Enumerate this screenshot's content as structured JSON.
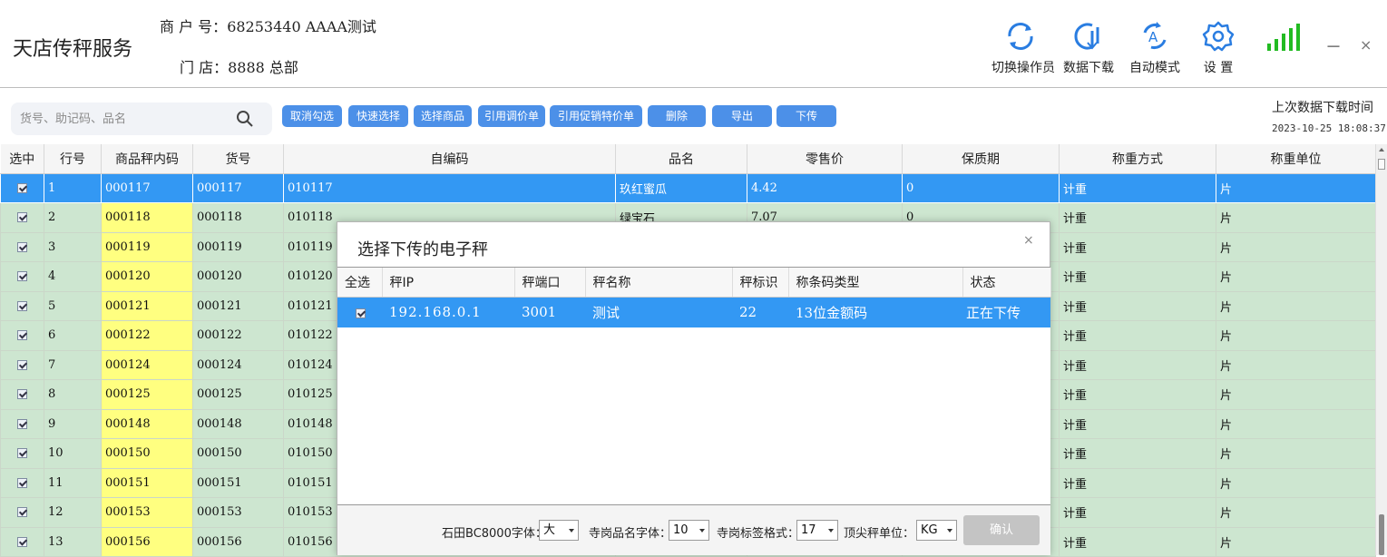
{
  "app": {
    "title": "天店传秤服务"
  },
  "merchant": {
    "label": "商 户 号：",
    "value": "68253440  AAAA测试"
  },
  "store": {
    "label": "门    店：",
    "value": "8888 总部"
  },
  "toolbar_top": [
    {
      "label": "切换操作员",
      "icon": "switch-operator-icon"
    },
    {
      "label": "数据下载",
      "icon": "data-download-icon"
    },
    {
      "label": "自动模式",
      "icon": "auto-mode-icon"
    },
    {
      "label": "设  置",
      "icon": "gear-icon"
    }
  ],
  "window": {
    "minimize": "－",
    "close": "×",
    "signal_color": "#22bb22"
  },
  "search": {
    "placeholder": "货号、助记码、品名"
  },
  "actions": [
    "取消勾选",
    "快速选择",
    "选择商品",
    "引用调价单",
    "引用促销特价单",
    "删除",
    "导出",
    "下传"
  ],
  "last_download": {
    "label": "上次数据下载时间",
    "time": "2023-10-25 18:08:37"
  },
  "colors": {
    "accent": "#4c90e8",
    "selected_row": "#3398f3",
    "row_bg": "#cde6d0",
    "code_bg": "#ffff80"
  },
  "table": {
    "headers": [
      "选中",
      "行号",
      "商品秤内码",
      "货号",
      "自编码",
      "品名",
      "零售价",
      "保质期",
      "称重方式",
      "称重单位"
    ],
    "rows": [
      {
        "no": "1",
        "code": "000117",
        "sku": "000117",
        "self": "010117",
        "name": "玖红蜜瓜",
        "price": "4.42",
        "shelf": "0",
        "method": "计重",
        "unit": "片"
      },
      {
        "no": "2",
        "code": "000118",
        "sku": "000118",
        "self": "010118",
        "name": "绿宝石",
        "price": "7.07",
        "shelf": "0",
        "method": "计重",
        "unit": "片"
      },
      {
        "no": "3",
        "code": "000119",
        "sku": "000119",
        "self": "010119",
        "name": "",
        "price": "",
        "shelf": "",
        "method": "计重",
        "unit": "片"
      },
      {
        "no": "4",
        "code": "000120",
        "sku": "000120",
        "self": "010120",
        "name": "",
        "price": "",
        "shelf": "",
        "method": "计重",
        "unit": "片"
      },
      {
        "no": "5",
        "code": "000121",
        "sku": "000121",
        "self": "010121",
        "name": "",
        "price": "",
        "shelf": "",
        "method": "计重",
        "unit": "片"
      },
      {
        "no": "6",
        "code": "000122",
        "sku": "000122",
        "self": "010122",
        "name": "",
        "price": "",
        "shelf": "",
        "method": "计重",
        "unit": "片"
      },
      {
        "no": "7",
        "code": "000124",
        "sku": "000124",
        "self": "010124",
        "name": "",
        "price": "",
        "shelf": "",
        "method": "计重",
        "unit": "片"
      },
      {
        "no": "8",
        "code": "000125",
        "sku": "000125",
        "self": "010125",
        "name": "",
        "price": "",
        "shelf": "",
        "method": "计重",
        "unit": "片"
      },
      {
        "no": "9",
        "code": "000148",
        "sku": "000148",
        "self": "010148",
        "name": "",
        "price": "",
        "shelf": "",
        "method": "计重",
        "unit": "片"
      },
      {
        "no": "10",
        "code": "000150",
        "sku": "000150",
        "self": "010150",
        "name": "",
        "price": "",
        "shelf": "",
        "method": "计重",
        "unit": "片"
      },
      {
        "no": "11",
        "code": "000151",
        "sku": "000151",
        "self": "010151",
        "name": "",
        "price": "",
        "shelf": "",
        "method": "计重",
        "unit": "片"
      },
      {
        "no": "12",
        "code": "000153",
        "sku": "000153",
        "self": "010153",
        "name": "",
        "price": "",
        "shelf": "",
        "method": "计重",
        "unit": "片"
      },
      {
        "no": "13",
        "code": "000156",
        "sku": "000156",
        "self": "010156",
        "name": "",
        "price": "",
        "shelf": "",
        "method": "计重",
        "unit": "片"
      }
    ]
  },
  "modal": {
    "title": "选择下传的电子秤",
    "close": "×",
    "headers": [
      "全选",
      "秤IP",
      "秤端口",
      "秤名称",
      "秤标识",
      "称条码类型",
      "状态"
    ],
    "rows": [
      {
        "ip": "192.168.0.1",
        "port": "3001",
        "name": "测试",
        "id": "22",
        "barcode": "13位金额码",
        "status": "正在下传"
      }
    ],
    "footer": {
      "font_label": "石田BC8000字体：",
      "font_value": "大",
      "name_font_label": "寺岗品名字体：",
      "name_font_value": "10",
      "label_format_label": "寺岗标签格式：",
      "label_format_value": "17",
      "unit_label": "顶尖秤单位：",
      "unit_value": "KG",
      "confirm": "确认"
    }
  }
}
